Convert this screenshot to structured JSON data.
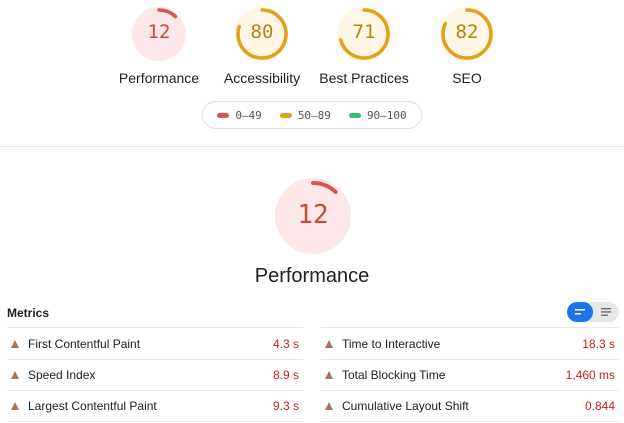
{
  "summary": {
    "gauges": [
      {
        "score": "12",
        "label": "Performance",
        "fraction": 0.12,
        "color": "#d9534f",
        "bg": "#fce8e8"
      },
      {
        "score": "80",
        "label": "Accessibility",
        "fraction": 0.8,
        "color": "#e0a21b",
        "bg": "#fff6e6"
      },
      {
        "score": "71",
        "label": "Best Practices",
        "fraction": 0.71,
        "color": "#e0a21b",
        "bg": "#fff6e6"
      },
      {
        "score": "82",
        "label": "SEO",
        "fraction": 0.82,
        "color": "#e0a21b",
        "bg": "#fff6e6"
      }
    ]
  },
  "legend": [
    {
      "label": "0–49",
      "color": "#d9534f"
    },
    {
      "label": "50–89",
      "color": "#e0a21b"
    },
    {
      "label": "90–100",
      "color": "#2fbf71"
    }
  ],
  "performance": {
    "score": "12",
    "fraction": 0.12,
    "title": "Performance",
    "color": "#d9534f",
    "bg": "#fce8e8"
  },
  "metrics": {
    "title": "Metrics",
    "toggle": {
      "active_color": "#1a73e8"
    },
    "left": [
      {
        "name": "First Contentful Paint",
        "value": "4.3 s"
      },
      {
        "name": "Speed Index",
        "value": "8.9 s"
      },
      {
        "name": "Largest Contentful Paint",
        "value": "9.3 s"
      }
    ],
    "right": [
      {
        "name": "Time to Interactive",
        "value": "18.3 s"
      },
      {
        "name": "Total Blocking Time",
        "value": "1,460 ms"
      },
      {
        "name": "Cumulative Layout Shift",
        "value": "0.844"
      }
    ],
    "status_icon": "warning-triangle-icon"
  }
}
